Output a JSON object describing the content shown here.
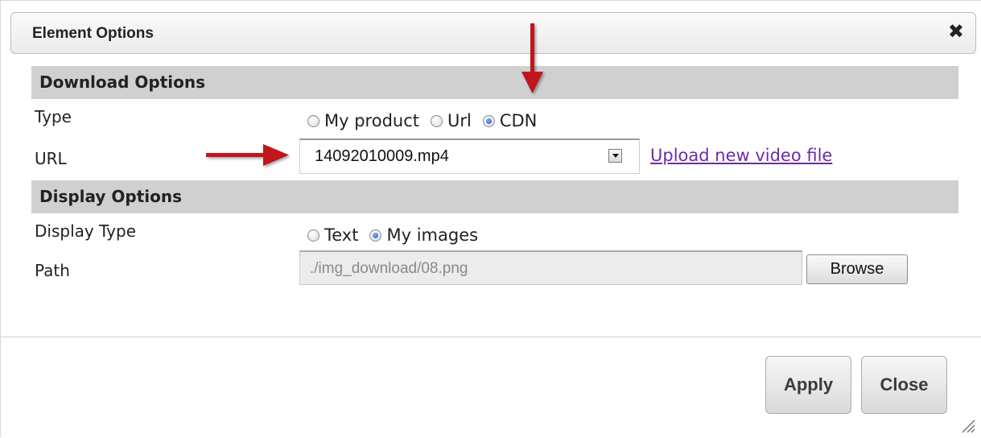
{
  "dialog": {
    "title": "Element Options",
    "close_icon": "close-icon"
  },
  "download_options": {
    "header": "Download Options",
    "type_label": "Type",
    "type_options": [
      {
        "label": "My product",
        "checked": false
      },
      {
        "label": "Url",
        "checked": false
      },
      {
        "label": "CDN",
        "checked": true
      }
    ],
    "url_label": "URL",
    "url_value": "14092010009.mp4",
    "upload_link": "Upload new video file"
  },
  "display_options": {
    "header": "Display Options",
    "display_type_label": "Display Type",
    "display_type_options": [
      {
        "label": "Text",
        "checked": false
      },
      {
        "label": "My images",
        "checked": true
      }
    ],
    "path_label": "Path",
    "path_value": "./img_download/08.png",
    "browse_label": "Browse"
  },
  "footer": {
    "apply_label": "Apply",
    "close_label": "Close"
  },
  "colors": {
    "arrow": "#c0121b",
    "link": "#6a2ca8",
    "section_header_bg": "#d0d0d0"
  }
}
